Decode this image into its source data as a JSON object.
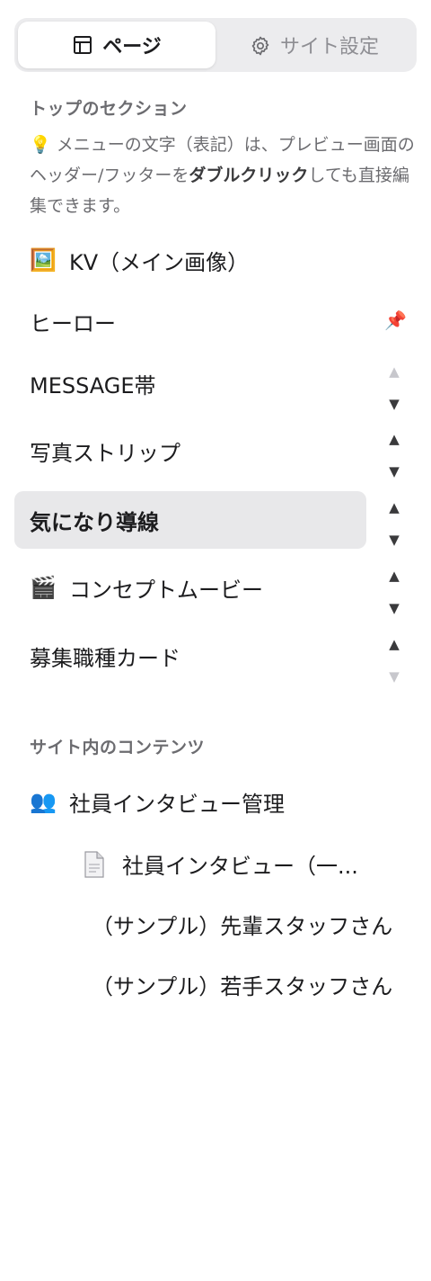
{
  "tabs": [
    {
      "label": "ページ",
      "icon": "layout-icon",
      "active": true
    },
    {
      "label": "サイト設定",
      "icon": "gear-icon",
      "active": false
    }
  ],
  "top_section": {
    "heading": "トップのセクション",
    "hint_icon": "💡",
    "hint_part1": " メニューの文字（表記）は、プレビュー画面のヘッダー/フッターを",
    "hint_bold": "ダブルクリック",
    "hint_part2": "しても直接編集できます。",
    "items": [
      {
        "emoji": "🖼️",
        "label": "KV（メイン画像）",
        "control": "none"
      },
      {
        "emoji": "",
        "label": "ヒーロー",
        "control": "pin",
        "pin_icon": "📌"
      },
      {
        "emoji": "",
        "label": "MESSAGE帯",
        "control": "arrows",
        "up_enabled": false,
        "down_enabled": true
      },
      {
        "emoji": "",
        "label": "写真ストリップ",
        "control": "arrows",
        "up_enabled": true,
        "down_enabled": true
      },
      {
        "emoji": "",
        "label": "気になり導線",
        "control": "arrows",
        "up_enabled": true,
        "down_enabled": true,
        "active": true
      },
      {
        "emoji": "🎬",
        "label": "コンセプトムービー",
        "control": "arrows",
        "up_enabled": true,
        "down_enabled": true
      },
      {
        "emoji": "",
        "label": "募集職種カード",
        "control": "arrows",
        "up_enabled": true,
        "down_enabled": false
      }
    ],
    "arrow_up": "▲",
    "arrow_down": "▼"
  },
  "contents_section": {
    "heading": "サイト内のコンテンツ",
    "group": {
      "emoji": "👥",
      "label": "社員インタビュー管理"
    },
    "doc_item": {
      "icon": "document-icon",
      "label": "社員インタビュー（一..."
    },
    "entries": [
      "（サンプル）先輩スタッフさん",
      "（サンプル）若手スタッフさん"
    ]
  }
}
